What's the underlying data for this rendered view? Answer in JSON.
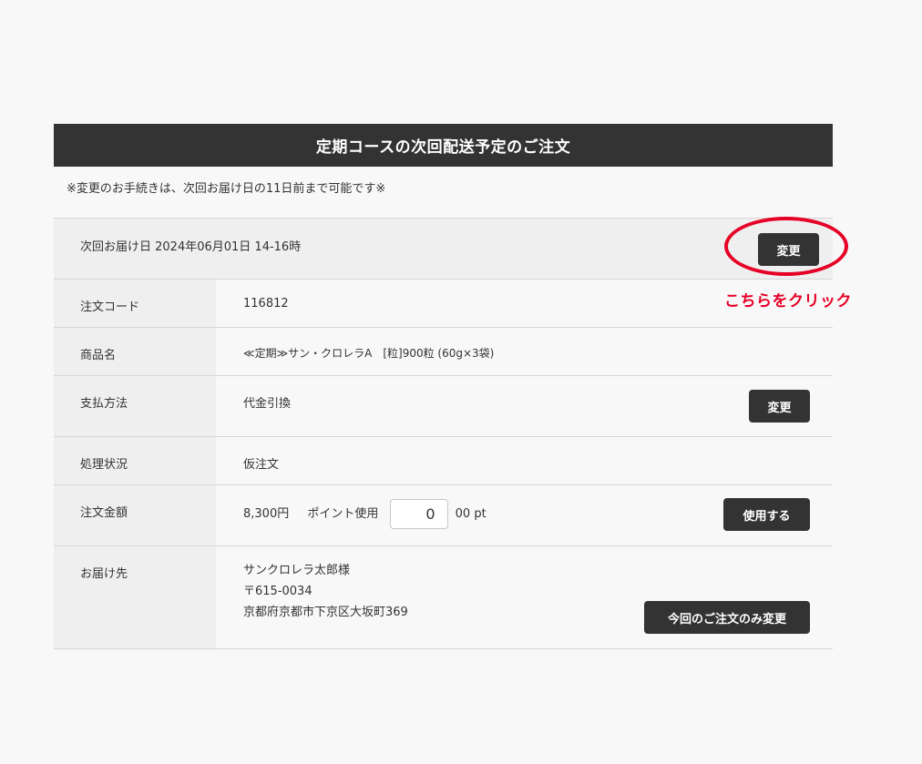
{
  "page": {
    "title": "定期コースの次回配送予定のご注文",
    "notice": "※変更のお手続きは、次回お届け日の11日前まで可能です※"
  },
  "delivery": {
    "label_and_date": "次回お届け日 2024年06月01日 14-16時",
    "change_label": "変更"
  },
  "rows": {
    "order_code": {
      "label": "注文コード",
      "value": "116812"
    },
    "product": {
      "label": "商品名",
      "value": "≪定期≫サン・クロレラA　[粒]900粒 (60g×3袋)"
    },
    "payment": {
      "label": "支払方法",
      "value": "代金引換",
      "button": "変更"
    },
    "status": {
      "label": "処理状況",
      "value": "仮注文"
    },
    "amount": {
      "label": "注文金額",
      "price": "8,300円",
      "points_label": "ポイント使用",
      "points_value": "0",
      "points_unit": "00 pt",
      "button": "使用する"
    },
    "destination": {
      "label": "お届け先",
      "name": "サンクロレラ太郎様",
      "postal": "〒615-0034",
      "address": "京都府京都市下京区大坂町369",
      "button": "今回のご注文のみ変更"
    }
  },
  "annotation": {
    "text": "こちらをクリック",
    "color": "#e60026"
  },
  "colors": {
    "header_bg": "#333333",
    "label_bg": "#efefef",
    "button_bg": "#333333"
  }
}
